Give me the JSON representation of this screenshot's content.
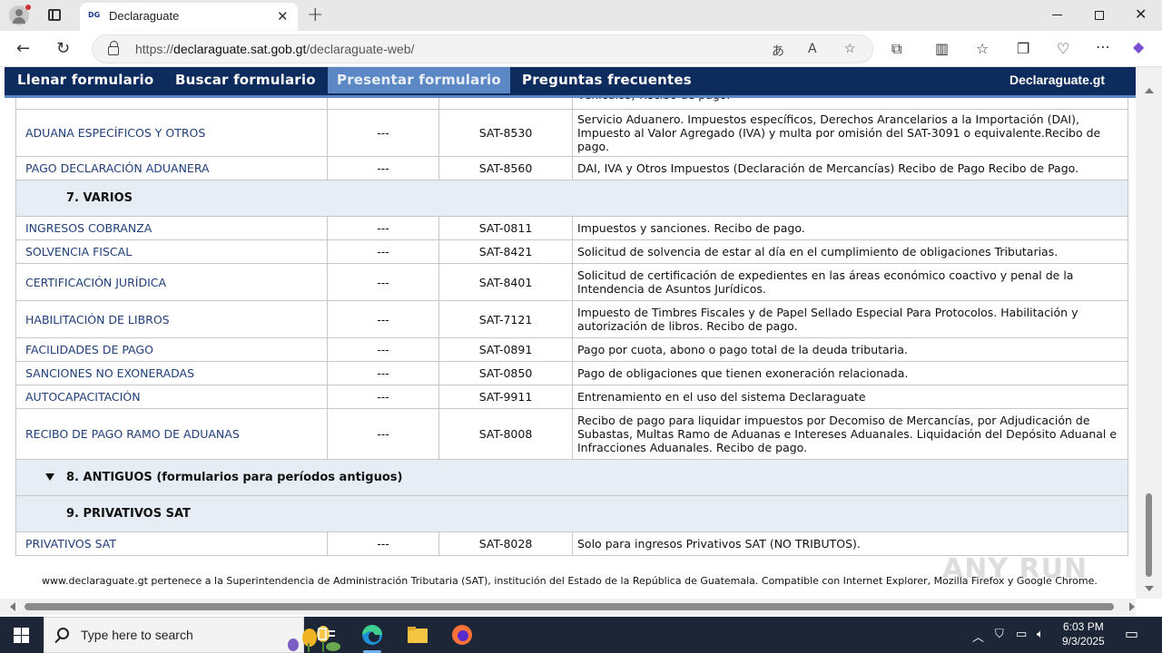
{
  "browser": {
    "tab_title": "Declaraguate",
    "url_prefix": "https://",
    "url_domain": "declaraguate.sat.gob.gt",
    "url_path": "/declaraguate-web/",
    "tab_close": "✕",
    "new_tab": "+"
  },
  "site": {
    "menu": [
      {
        "label": "Llenar formulario"
      },
      {
        "label": "Buscar formulario"
      },
      {
        "label": "Presentar formulario"
      },
      {
        "label": "Preguntas frecuentes"
      }
    ],
    "brand": "Declaraguate.gt",
    "active_menu_color": "#5b87c5",
    "header_color": "#0d2b5c"
  },
  "table": {
    "partial_top_text": "Vehículos) Recibo de pago.",
    "rows_a": [
      {
        "name": "ADUANA ESPECÍFICOS Y OTROS",
        "version": "---",
        "code": "SAT-8530",
        "desc": "Servicio Aduanero. Impuestos específicos, Derechos Arancelarios a la Importación (DAI), Impuesto al Valor Agregado (IVA) y multa por omisión del SAT-3091 o equivalente.Recibo de pago."
      },
      {
        "name": "PAGO DECLARACIÓN ADUANERA",
        "version": "---",
        "code": "SAT-8560",
        "desc": "DAI, IVA y Otros Impuestos (Declaración de Mercancías) Recibo de Pago Recibo de Pago."
      }
    ],
    "section_7": "7. VARIOS",
    "rows_7": [
      {
        "name": "INGRESOS COBRANZA",
        "version": "---",
        "code": "SAT-0811",
        "desc": "Impuestos y sanciones. Recibo de pago."
      },
      {
        "name": "SOLVENCIA FISCAL",
        "version": "---",
        "code": "SAT-8421",
        "desc": "Solicitud de solvencia de estar al día en el cumplimiento de obligaciones Tributarias."
      },
      {
        "name": "CERTIFICACIÓN JURÍDICA",
        "version": "---",
        "code": "SAT-8401",
        "desc": "Solicitud de certificación de expedientes en las áreas económico coactivo y penal de la Intendencia de Asuntos Jurídicos."
      },
      {
        "name": "HABILITACIÓN DE LIBROS",
        "version": "---",
        "code": "SAT-7121",
        "desc": "Impuesto de Timbres Fiscales y de Papel Sellado Especial Para Protocolos. Habilitación y autorización de libros. Recibo de pago."
      },
      {
        "name": "FACILIDADES DE PAGO",
        "version": "---",
        "code": "SAT-0891",
        "desc": "Pago por cuota, abono o pago total de la deuda tributaria."
      },
      {
        "name": "SANCIONES NO EXONERADAS",
        "version": "---",
        "code": "SAT-0850",
        "desc": "Pago de obligaciones que tienen exoneración relacionada."
      },
      {
        "name": "AUTOCAPACITACIÓN",
        "version": "---",
        "code": "SAT-9911",
        "desc": "Entrenamiento en el uso del sistema Declaraguate"
      },
      {
        "name": "RECIBO DE PAGO RAMO DE ADUANAS",
        "version": "---",
        "code": "SAT-8008",
        "desc": "Recibo de pago para liquidar impuestos por Decomiso de Mercancías, por Adjudicación de Subastas, Multas Ramo de Aduanas e Intereses Aduanales. Liquidación del Depósito Aduanal e Infracciones Aduanales. Recibo de pago."
      }
    ],
    "section_8": "8. ANTIGUOS (formularios para períodos antiguos)",
    "section_9": "9. PRIVATIVOS SAT",
    "rows_9": [
      {
        "name": "PRIVATIVOS SAT",
        "version": "---",
        "code": "SAT-8028",
        "desc": "Solo para ingresos Privativos SAT (NO TRIBUTOS)."
      }
    ]
  },
  "footer": "www.declaraguate.gt pertenece a la Superintendencia de Administración Tributaria (SAT), institución del Estado de la República de Guatemala. Compatible con Internet Explorer, Mozilla Firefox y Google Chrome.",
  "watermark": "ANY RUN",
  "taskbar": {
    "search_placeholder": "Type here to search",
    "time": "6:03 PM",
    "date": "9/3/2025"
  }
}
